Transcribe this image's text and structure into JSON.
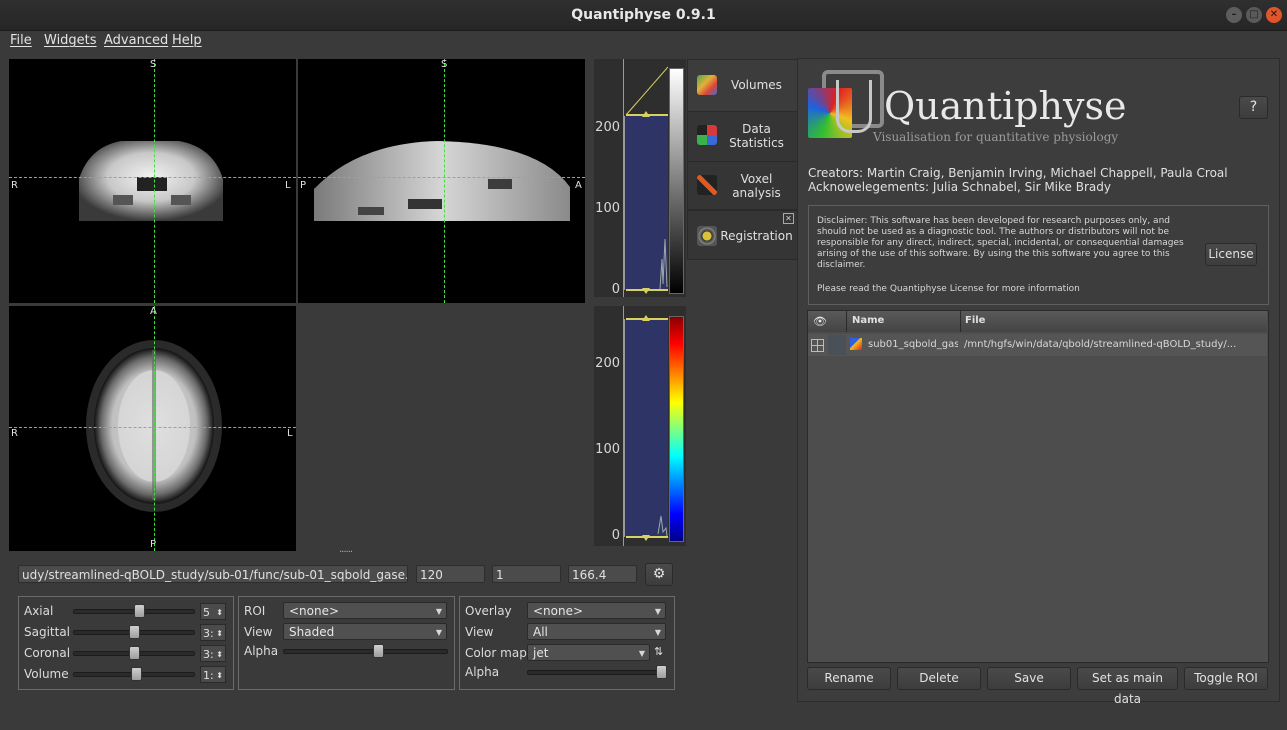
{
  "window": {
    "title": "Quantiphyse 0.9.1"
  },
  "menu": {
    "items": [
      "File",
      "Widgets",
      "Advanced",
      "Help"
    ]
  },
  "views": {
    "coronal": {
      "top": "S",
      "left": "R",
      "right": "L"
    },
    "sagittal": {
      "top": "S",
      "left": "P",
      "right": "A"
    },
    "axial": {
      "top": "A",
      "bottom": "P",
      "left": "R",
      "right": "L"
    },
    "crosshair_color": "#3ee33e",
    "splitter_handle": "......"
  },
  "histograms": {
    "main": {
      "ticks": [
        "200",
        "100",
        "0"
      ]
    },
    "overlay": {
      "ticks": [
        "200",
        "100",
        "0"
      ]
    }
  },
  "side_tabs": [
    {
      "label": "Volumes",
      "icon": "volumes-icon"
    },
    {
      "label": "Data Statistics",
      "icon": "statistics-icon"
    },
    {
      "label": "Voxel analysis",
      "icon": "voxel-analysis-icon"
    },
    {
      "label": "Registration",
      "icon": "registration-icon"
    }
  ],
  "status": {
    "file_path": "udy/streamlined-qBOLD_study/sub-01/func/sub-01_sqbold_gase.nii.gz",
    "value1": "120",
    "value2": "1",
    "value3": "166.4"
  },
  "nav": {
    "axial_label": "Axial",
    "axial_value": "5",
    "sagittal_label": "Sagittal",
    "sagittal_value": "3:",
    "coronal_label": "Coronal",
    "coronal_value": "3:",
    "volume_label": "Volume",
    "volume_value": "1:"
  },
  "roi": {
    "roi_label": "ROI",
    "roi_value": "<none>",
    "view_label": "View",
    "view_value": "Shaded",
    "alpha_label": "Alpha"
  },
  "overlay": {
    "overlay_label": "Overlay",
    "overlay_value": "<none>",
    "view_label": "View",
    "view_value": "All",
    "colormap_label": "Color map",
    "colormap_value": "jet",
    "alpha_label": "Alpha"
  },
  "about": {
    "logo_title": "Quantiphyse",
    "logo_subtitle": "Visualisation for quantitative physiology",
    "help_button": "?",
    "creators": "Creators: Martin Craig, Benjamin Irving, Michael Chappell, Paula Croal",
    "acknowledgements": "Acknowelegements: Julia Schnabel, Sir Mike Brady",
    "disclaimer": "Disclaimer: This software has been developed for research purposes only, and should not be used as a diagnostic tool. The authors or distributors will not be responsible for any direct, indirect, special, incidental, or consequential damages arising of the use of this software. By using the this software you agree to this disclaimer.",
    "license_note": "Please read the Quantiphyse License for more information",
    "license_button": "License"
  },
  "data_table": {
    "headers": {
      "name": "Name",
      "file": "File"
    },
    "rows": [
      {
        "name": "sub01_sqbold_gase",
        "file": "/mnt/hgfs/win/data/qbold/streamlined-qBOLD_study/..."
      }
    ]
  },
  "actions": {
    "rename": "Rename",
    "delete": "Delete",
    "save": "Save",
    "set_main": "Set as main data",
    "toggle_roi": "Toggle ROI"
  },
  "colors": {
    "histogram_fill": "#2f3466",
    "accent_yellow": "#d8d060"
  }
}
